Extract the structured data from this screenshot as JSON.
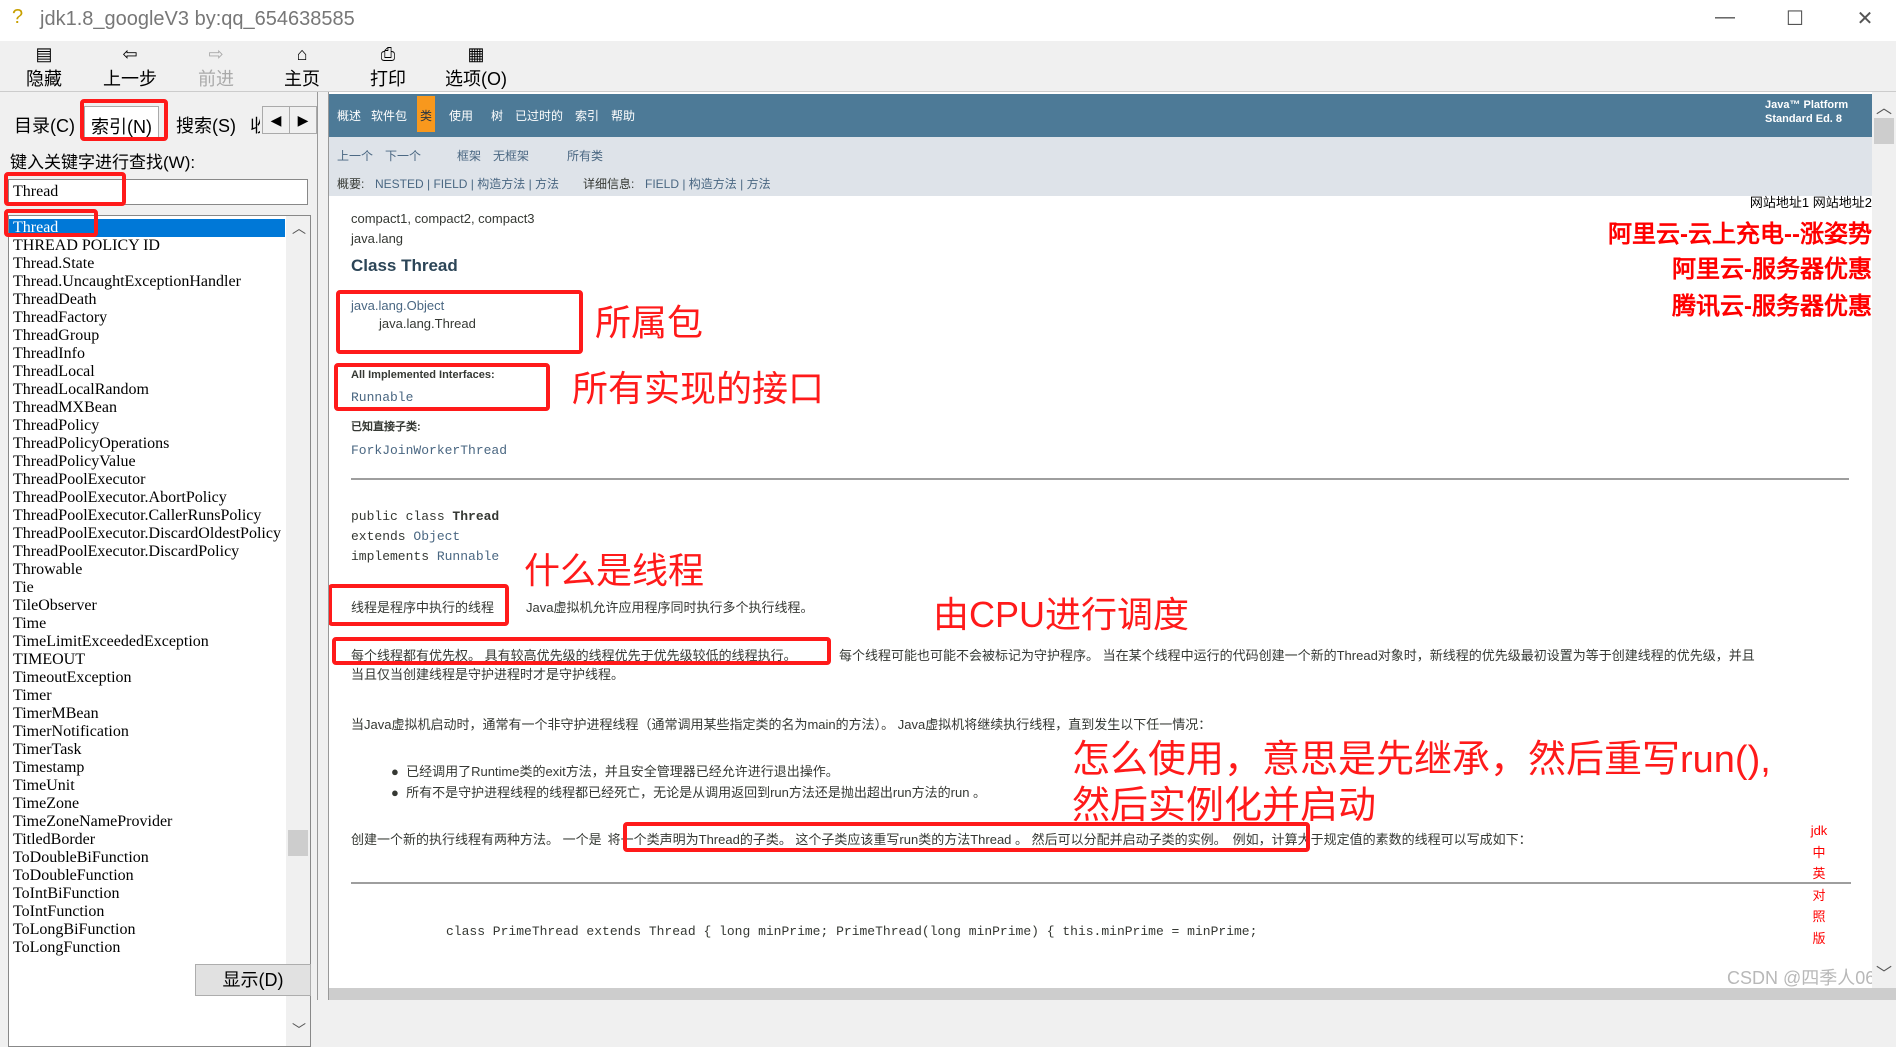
{
  "window": {
    "title": "jdk1.8_googleV3 by:qq_654638585"
  },
  "toolbar": [
    {
      "label": "隐藏",
      "icon": "hide-icon"
    },
    {
      "label": "上一步",
      "icon": "back-arrow-icon"
    },
    {
      "label": "前进",
      "icon": "forward-arrow-icon",
      "disabled": true
    },
    {
      "label": "主页",
      "icon": "home-icon"
    },
    {
      "label": "打印",
      "icon": "printer-icon"
    },
    {
      "label": "选项(O)",
      "icon": "options-icon"
    }
  ],
  "left": {
    "tabs": [
      "目录(C)",
      "索引(N)",
      "搜索(S)",
      "收"
    ],
    "active_tab": "索引(N)",
    "keyword_label": "键入关键字进行查找(W):",
    "keyword_value": "Thread",
    "items": [
      "Thread",
      "THREAD POLICY ID",
      "Thread.State",
      "Thread.UncaughtExceptionHandler",
      "ThreadDeath",
      "ThreadFactory",
      "ThreadGroup",
      "ThreadInfo",
      "ThreadLocal",
      "ThreadLocalRandom",
      "ThreadMXBean",
      "ThreadPolicy",
      "ThreadPolicyOperations",
      "ThreadPolicyValue",
      "ThreadPoolExecutor",
      "ThreadPoolExecutor.AbortPolicy",
      "ThreadPoolExecutor.CallerRunsPolicy",
      "ThreadPoolExecutor.DiscardOldestPolicy",
      "ThreadPoolExecutor.DiscardPolicy",
      "Throwable",
      "Tie",
      "TileObserver",
      "Time",
      "TimeLimitExceededException",
      "TIMEOUT",
      "TimeoutException",
      "Timer",
      "TimerMBean",
      "TimerNotification",
      "TimerTask",
      "Timestamp",
      "TimeUnit",
      "TimeZone",
      "TimeZoneNameProvider",
      "TitledBorder",
      "ToDoubleBiFunction",
      "ToDoubleFunction",
      "ToIntBiFunction",
      "ToIntFunction",
      "ToLongBiFunction",
      "ToLongFunction"
    ],
    "selected_index": 0,
    "display_button": "显示(D)"
  },
  "doc": {
    "nav_top": [
      "概述",
      "软件包",
      "类",
      "使用",
      "树",
      "已过时的",
      "索引",
      "帮助"
    ],
    "nav_current": "类",
    "platform": [
      "Java™ Platform",
      "Standard Ed. 8"
    ],
    "nav_sub1": {
      "prev": "上一个",
      "next": "下一个",
      "frames": "框架",
      "noframes": "无框架",
      "all": "所有类"
    },
    "nav_sub2": {
      "summary_label": "概要:",
      "summary": "NESTED | FIELD | 构造方法 | 方法",
      "detail_label": "详细信息:",
      "detail": "FIELD | 构造方法 | 方法"
    },
    "site_links": "网站地址1 网站地址2",
    "ads": [
      "阿里云-云上充电--涨姿势",
      "阿里云-服务器优惠",
      "腾讯云-服务器优惠"
    ],
    "profiles": "compact1, compact2, compact3",
    "package": "java.lang",
    "class_title": "Class Thread",
    "inherit": [
      "java.lang.Object",
      "java.lang.Thread"
    ],
    "interfaces_label": "All Implemented Interfaces:",
    "interfaces": "Runnable",
    "subclasses_label": "已知直接子类:",
    "subclasses": "ForkJoinWorkerThread",
    "decl": {
      "l1a": "public class ",
      "l1b": "Thread",
      "l2a": "extends ",
      "l2b": "Object",
      "l3a": "implements ",
      "l3b": "Runnable"
    },
    "p1a": "线程是程序中执行的线程",
    "p1b": "Java虚拟机允许应用程序同时执行多个执行线程。",
    "p2a": "每个线程都有优先权。 具有较高优先级的线程优先于优先级较低的线程执行。",
    "p2b": "每个线程可能也可能不会被标记为守护程序。 当在某个线程中运行的代码创建一个新的Thread对象时，新线程的优先级最初设置为等于创建线程的优先级，并且",
    "p2c": "当且仅当创建线程是守护进程时才是守护线程。",
    "p3": "当Java虚拟机启动时，通常有一个非守护进程线程（通常调用某些指定类的名为main的方法）。 Java虚拟机将继续执行线程，直到发生以下任一情况：",
    "bullets": [
      "已经调用了Runtime类的exit方法，并且安全管理器已经允许进行退出操作。",
      "所有不是守护进程线程的线程都已经死亡，无论是从调用返回到run方法还是抛出超出run方法的run 。"
    ],
    "p4a": "创建一个新的执行线程有两种方法。 一个是",
    "p4b": "将一个类声明为Thread的子类。 这个子类应该重写run类的方法Thread 。 然后可以分配并启动子类的实例。",
    "p4c": "例如，计算大于规定值的素数的线程可以写成如下：",
    "code": [
      "class PrimeThread extends Thread {",
      "    long minPrime;",
      "    PrimeThread(long minPrime) {",
      "        this.minPrime = minPrime;"
    ],
    "side_link": [
      "jdk",
      "中",
      "英",
      "对",
      "照",
      "版"
    ]
  },
  "annotations": {
    "package": "所属包",
    "interfaces": "所有实现的接口",
    "what_is_thread": "什么是线程",
    "cpu": "由CPU进行调度",
    "how_to_use_1": "怎么使用，意思是先继承，然后重写run(),",
    "how_to_use_2": "然后实例化并启动"
  },
  "watermark": "CSDN @四季人06",
  "colors": {
    "nav": "#4d7a97",
    "nav_current": "#f8981d",
    "subnav": "#dee3e9",
    "selection": "#0078d7",
    "annotation": "#ff1a1a",
    "link": "#4a6782"
  }
}
